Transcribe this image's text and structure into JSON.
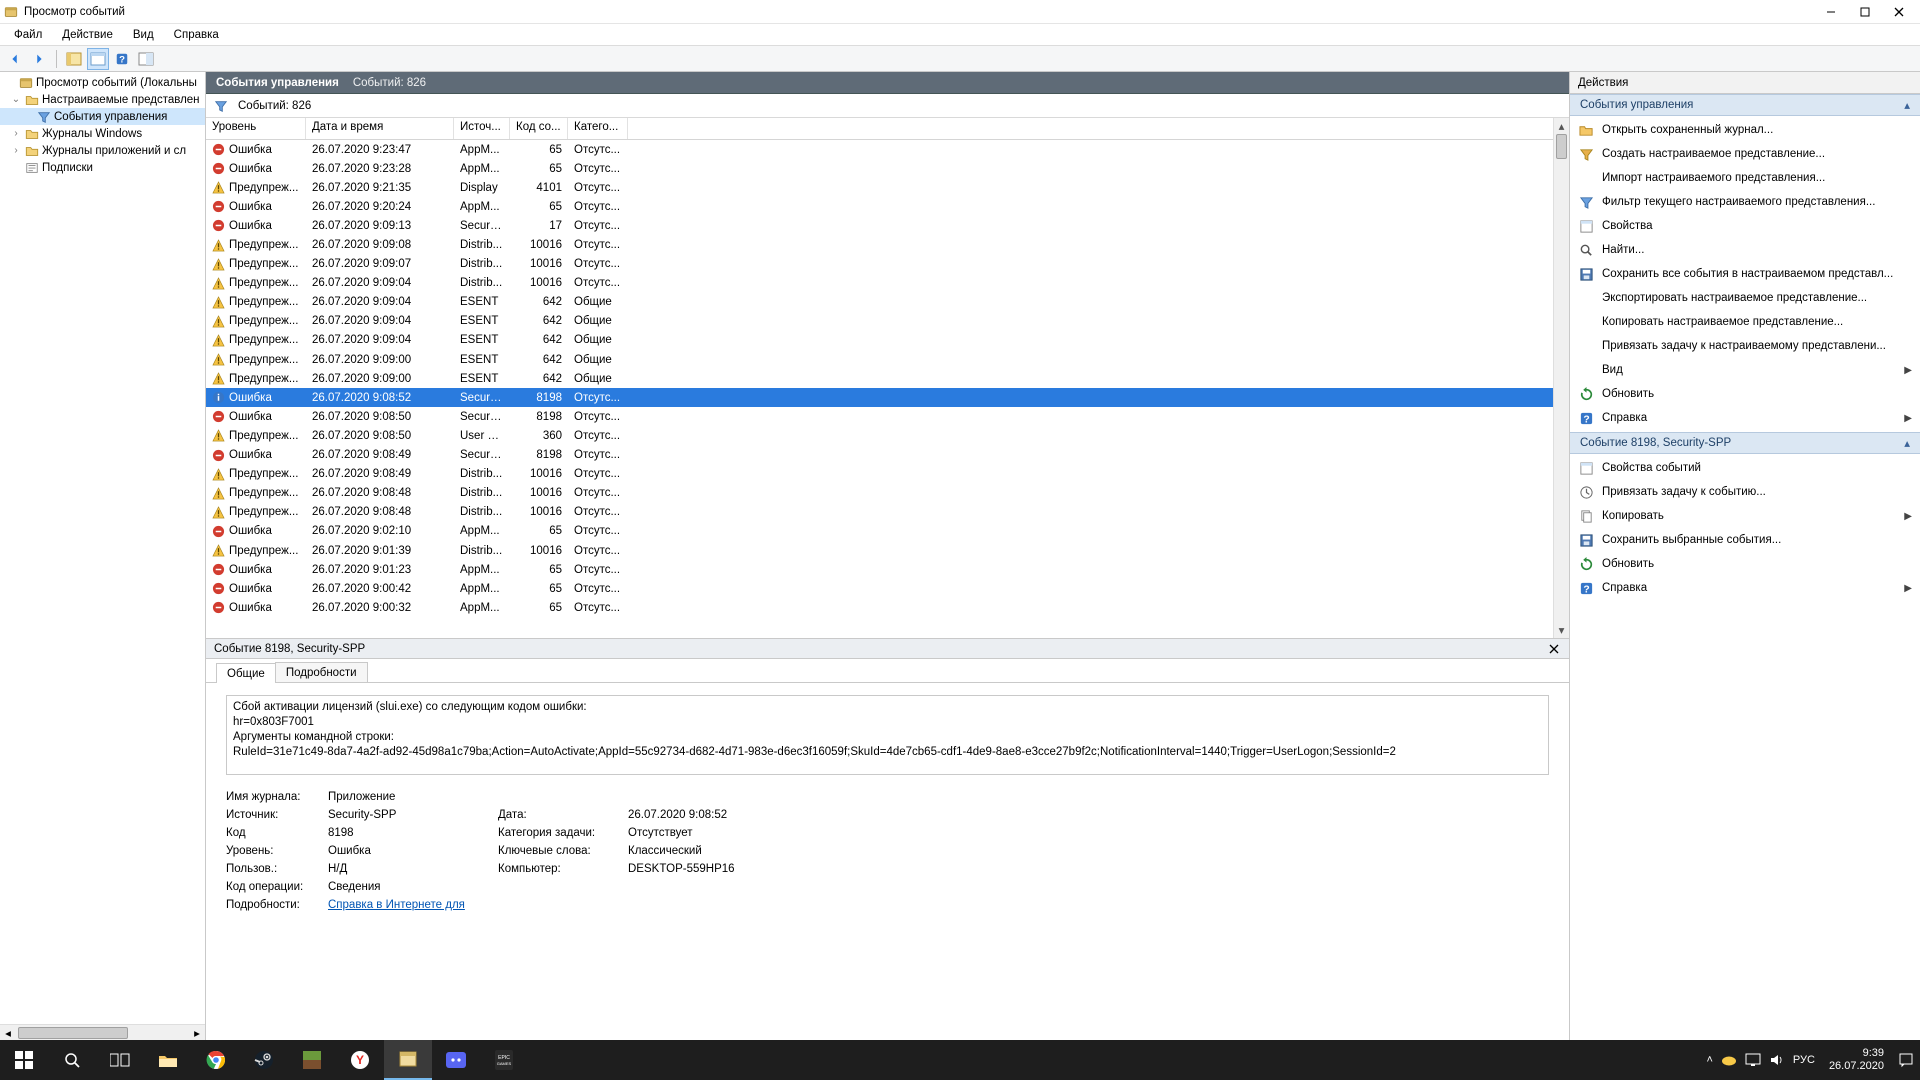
{
  "title": "Просмотр событий",
  "menu": {
    "file": "Файл",
    "action": "Действие",
    "view": "Вид",
    "help": "Справка"
  },
  "tree": {
    "root": "Просмотр событий (Локальны",
    "custom_views": "Настраиваемые представлен",
    "admin_events": "События управления",
    "windows_logs": "Журналы Windows",
    "apps_logs": "Журналы приложений и сл",
    "subscriptions": "Подписки"
  },
  "center_header": {
    "title": "События управления",
    "count_label": "Событий: 826"
  },
  "filter": {
    "count_label": "Событий: 826"
  },
  "columns": {
    "level": "Уровень",
    "date": "Дата и время",
    "source": "Источ...",
    "code": "Код со...",
    "cat": "Катего..."
  },
  "events": [
    {
      "lvl": "error",
      "level": "Ошибка",
      "date": "26.07.2020 9:23:47",
      "src": "AppM...",
      "code": "65",
      "cat": "Отсутс..."
    },
    {
      "lvl": "error",
      "level": "Ошибка",
      "date": "26.07.2020 9:23:28",
      "src": "AppM...",
      "code": "65",
      "cat": "Отсутс..."
    },
    {
      "lvl": "warn",
      "level": "Предупреж...",
      "date": "26.07.2020 9:21:35",
      "src": "Display",
      "code": "4101",
      "cat": "Отсутс..."
    },
    {
      "lvl": "error",
      "level": "Ошибка",
      "date": "26.07.2020 9:20:24",
      "src": "AppM...",
      "code": "65",
      "cat": "Отсутс..."
    },
    {
      "lvl": "error",
      "level": "Ошибка",
      "date": "26.07.2020 9:09:13",
      "src": "Securit...",
      "code": "17",
      "cat": "Отсутс..."
    },
    {
      "lvl": "warn",
      "level": "Предупреж...",
      "date": "26.07.2020 9:09:08",
      "src": "Distrib...",
      "code": "10016",
      "cat": "Отсутс..."
    },
    {
      "lvl": "warn",
      "level": "Предупреж...",
      "date": "26.07.2020 9:09:07",
      "src": "Distrib...",
      "code": "10016",
      "cat": "Отсутс..."
    },
    {
      "lvl": "warn",
      "level": "Предупреж...",
      "date": "26.07.2020 9:09:04",
      "src": "Distrib...",
      "code": "10016",
      "cat": "Отсутс..."
    },
    {
      "lvl": "warn",
      "level": "Предупреж...",
      "date": "26.07.2020 9:09:04",
      "src": "ESENT",
      "code": "642",
      "cat": "Общие"
    },
    {
      "lvl": "warn",
      "level": "Предупреж...",
      "date": "26.07.2020 9:09:04",
      "src": "ESENT",
      "code": "642",
      "cat": "Общие"
    },
    {
      "lvl": "warn",
      "level": "Предупреж...",
      "date": "26.07.2020 9:09:04",
      "src": "ESENT",
      "code": "642",
      "cat": "Общие"
    },
    {
      "lvl": "warn",
      "level": "Предупреж...",
      "date": "26.07.2020 9:09:00",
      "src": "ESENT",
      "code": "642",
      "cat": "Общие"
    },
    {
      "lvl": "warn",
      "level": "Предупреж...",
      "date": "26.07.2020 9:09:00",
      "src": "ESENT",
      "code": "642",
      "cat": "Общие"
    },
    {
      "lvl": "info",
      "level": "Ошибка",
      "date": "26.07.2020 9:08:52",
      "src": "Securit...",
      "code": "8198",
      "cat": "Отсутс...",
      "selected": true
    },
    {
      "lvl": "error",
      "level": "Ошибка",
      "date": "26.07.2020 9:08:50",
      "src": "Securit...",
      "code": "8198",
      "cat": "Отсутс..."
    },
    {
      "lvl": "warn",
      "level": "Предупреж...",
      "date": "26.07.2020 9:08:50",
      "src": "User D...",
      "code": "360",
      "cat": "Отсутс..."
    },
    {
      "lvl": "error",
      "level": "Ошибка",
      "date": "26.07.2020 9:08:49",
      "src": "Securit...",
      "code": "8198",
      "cat": "Отсутс..."
    },
    {
      "lvl": "warn",
      "level": "Предупреж...",
      "date": "26.07.2020 9:08:49",
      "src": "Distrib...",
      "code": "10016",
      "cat": "Отсутс..."
    },
    {
      "lvl": "warn",
      "level": "Предупреж...",
      "date": "26.07.2020 9:08:48",
      "src": "Distrib...",
      "code": "10016",
      "cat": "Отсутс..."
    },
    {
      "lvl": "warn",
      "level": "Предупреж...",
      "date": "26.07.2020 9:08:48",
      "src": "Distrib...",
      "code": "10016",
      "cat": "Отсутс..."
    },
    {
      "lvl": "error",
      "level": "Ошибка",
      "date": "26.07.2020 9:02:10",
      "src": "AppM...",
      "code": "65",
      "cat": "Отсутс..."
    },
    {
      "lvl": "warn",
      "level": "Предупреж...",
      "date": "26.07.2020 9:01:39",
      "src": "Distrib...",
      "code": "10016",
      "cat": "Отсутс..."
    },
    {
      "lvl": "error",
      "level": "Ошибка",
      "date": "26.07.2020 9:01:23",
      "src": "AppM...",
      "code": "65",
      "cat": "Отсутс..."
    },
    {
      "lvl": "error",
      "level": "Ошибка",
      "date": "26.07.2020 9:00:42",
      "src": "AppM...",
      "code": "65",
      "cat": "Отсутс..."
    },
    {
      "lvl": "error",
      "level": "Ошибка",
      "date": "26.07.2020 9:00:32",
      "src": "AppM...",
      "code": "65",
      "cat": "Отсутс..."
    }
  ],
  "detail": {
    "title": "Событие 8198, Security-SPP",
    "tabs": {
      "general": "Общие",
      "details": "Подробности"
    },
    "text": "Сбой активации лицензий (slui.exe) со следующим кодом ошибки:\nhr=0x803F7001\nАргументы командной строки:\nRuleId=31e71c49-8da7-4a2f-ad92-45d98a1c79ba;Action=AutoActivate;AppId=55c92734-d682-4d71-983e-d6ec3f16059f;SkuId=4de7cb65-cdf1-4de9-8ae8-e3cce27b9f2c;NotificationInterval=1440;Trigger=UserLogon;SessionId=2",
    "grid": {
      "log_label": "Имя журнала:",
      "log": "Приложение",
      "src_label": "Источник:",
      "src": "Security-SPP",
      "date_label": "Дата:",
      "date": "26.07.2020 9:08:52",
      "code_label": "Код",
      "code": "8198",
      "taskcat_label": "Категория задачи:",
      "taskcat": "Отсутствует",
      "level_label": "Уровень:",
      "level": "Ошибка",
      "keywords_label": "Ключевые слова:",
      "keywords": "Классический",
      "user_label": "Пользов.:",
      "user": "Н/Д",
      "computer_label": "Компьютер:",
      "computer": "DESKTOP-559HP16",
      "opcode_label": "Код операции:",
      "opcode": "Сведения",
      "more_label": "Подробности:",
      "more_link": "Справка в Интернете для "
    }
  },
  "actions": {
    "panel_title": "Действия",
    "group1": "События управления",
    "group2": "Событие 8198, Security-SPP",
    "items1": [
      {
        "icon": "open",
        "label": "Открыть сохраненный журнал..."
      },
      {
        "icon": "create",
        "label": "Создать настраиваемое представление..."
      },
      {
        "icon": "blank",
        "label": "Импорт настраиваемого представления..."
      },
      {
        "icon": "filter",
        "label": "Фильтр текущего настраиваемого представления..."
      },
      {
        "icon": "props",
        "label": "Свойства"
      },
      {
        "icon": "find",
        "label": "Найти..."
      },
      {
        "icon": "save",
        "label": "Сохранить все события в настраиваемом представл..."
      },
      {
        "icon": "blank",
        "label": "Экспортировать настраиваемое представление..."
      },
      {
        "icon": "blank",
        "label": "Копировать настраиваемое представление..."
      },
      {
        "icon": "blank",
        "label": "Привязать задачу к настраиваемому представлени..."
      },
      {
        "icon": "blank",
        "label": "Вид",
        "arrow": true
      },
      {
        "icon": "refresh",
        "label": "Обновить"
      },
      {
        "icon": "help",
        "label": "Справка",
        "arrow": true
      }
    ],
    "items2": [
      {
        "icon": "props",
        "label": "Свойства событий"
      },
      {
        "icon": "task",
        "label": "Привязать задачу к событию..."
      },
      {
        "icon": "copy",
        "label": "Копировать",
        "arrow": true
      },
      {
        "icon": "save",
        "label": "Сохранить выбранные события..."
      },
      {
        "icon": "refresh",
        "label": "Обновить"
      },
      {
        "icon": "help",
        "label": "Справка",
        "arrow": true
      }
    ]
  },
  "taskbar": {
    "lang": "РУС",
    "time": "9:39",
    "date": "26.07.2020"
  }
}
